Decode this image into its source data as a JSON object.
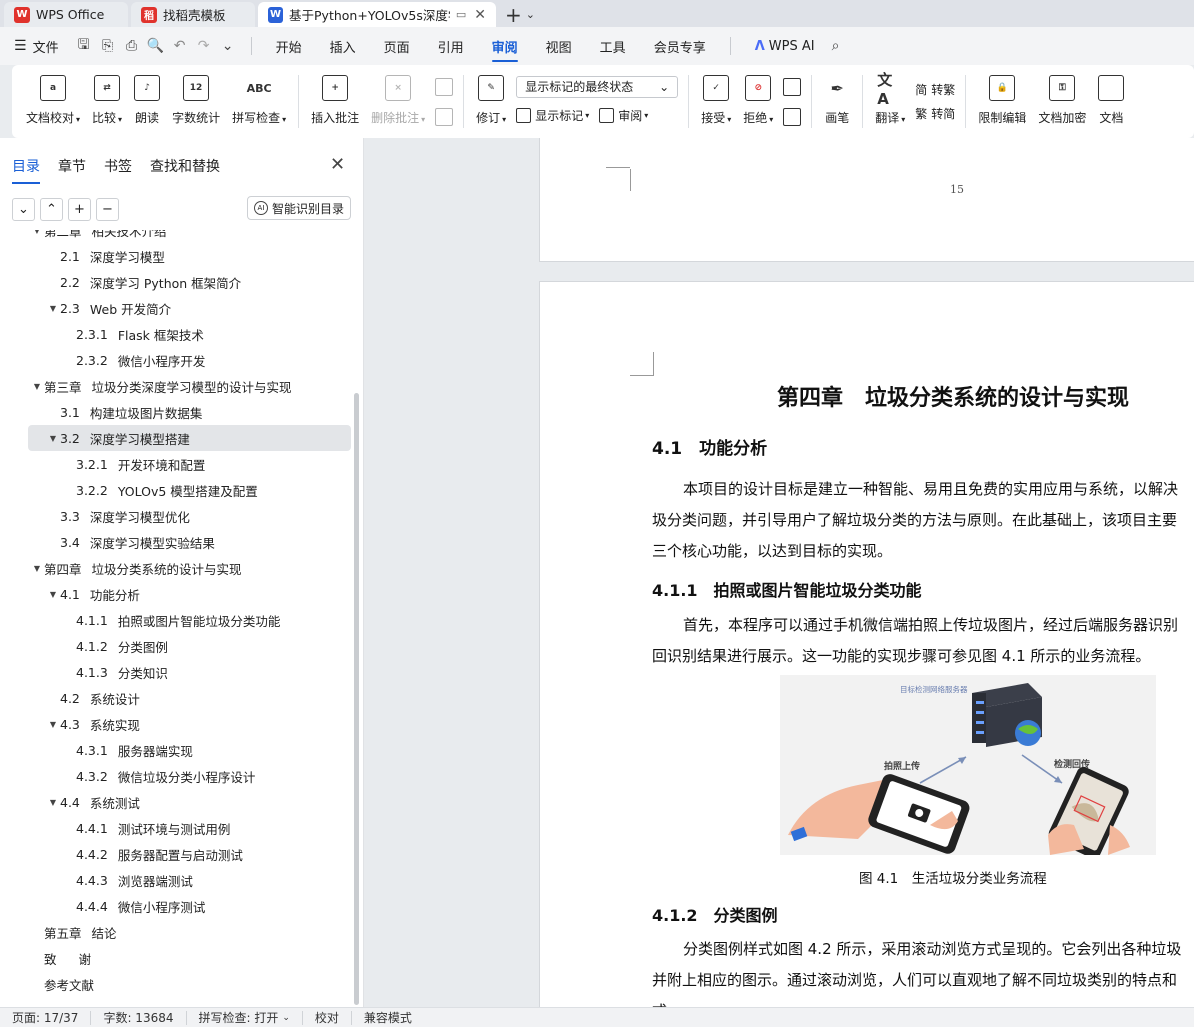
{
  "tabs": [
    {
      "label": "WPS Office",
      "logo": "W",
      "logo_color": "#e0322c",
      "active": false
    },
    {
      "label": "找稻壳模板",
      "logo": "稻",
      "logo_color": "#e0322c",
      "active": false
    },
    {
      "label": "基于Python+YOLOv5s深度学",
      "logo": "W",
      "logo_color": "#2b62d8",
      "active": true
    }
  ],
  "menubar": {
    "file_label": "文件",
    "items": [
      "开始",
      "插入",
      "页面",
      "引用",
      "审阅",
      "视图",
      "工具",
      "会员专享"
    ],
    "active_item": "审阅",
    "ai_label": "WPS AI"
  },
  "ribbon": {
    "proofread": "文档校对",
    "compare": "比较",
    "read_aloud": "朗读",
    "word_count": "字数统计",
    "spell_check": "拼写检查",
    "insert_comment": "插入批注",
    "delete_comment": "删除批注",
    "track_changes": "修订",
    "markup_state": "显示标记的最终状态",
    "show_markup": "显示标记",
    "review": "审阅",
    "accept": "接受",
    "reject": "拒绝",
    "ink": "画笔",
    "translate": "翻译",
    "to_traditional": "转繁",
    "to_simplified": "转简",
    "restrict_edit": "限制编辑",
    "encrypt": "文档加密",
    "doc_more": "文档"
  },
  "nav": {
    "tabs": [
      "目录",
      "章节",
      "书签",
      "查找和替换"
    ],
    "active_tab": "目录",
    "smart_toc": "智能识别目录",
    "toc": [
      {
        "level": 0,
        "arrow": "▼",
        "num": "第二章",
        "text": "相关技术介绍",
        "clipped": true
      },
      {
        "level": 1,
        "arrow": "",
        "num": "2.1",
        "text": "深度学习模型"
      },
      {
        "level": 1,
        "arrow": "",
        "num": "2.2",
        "text": "深度学习 Python 框架简介"
      },
      {
        "level": 1,
        "arrow": "▼",
        "num": "2.3",
        "text": "Web 开发简介"
      },
      {
        "level": 2,
        "arrow": "",
        "num": "2.3.1",
        "text": "Flask 框架技术"
      },
      {
        "level": 2,
        "arrow": "",
        "num": "2.3.2",
        "text": "微信小程序开发"
      },
      {
        "level": 0,
        "arrow": "▼",
        "num": "第三章",
        "text": "垃圾分类深度学习模型的设计与实现"
      },
      {
        "level": 1,
        "arrow": "",
        "num": "3.1",
        "text": "构建垃圾图片数据集"
      },
      {
        "level": 1,
        "arrow": "▼",
        "num": "3.2",
        "text": "深度学习模型搭建",
        "highlight": true
      },
      {
        "level": 2,
        "arrow": "",
        "num": "3.2.1",
        "text": "开发环境和配置"
      },
      {
        "level": 2,
        "arrow": "",
        "num": "3.2.2",
        "text": "YOLOv5 模型搭建及配置"
      },
      {
        "level": 1,
        "arrow": "",
        "num": "3.3",
        "text": "深度学习模型优化"
      },
      {
        "level": 1,
        "arrow": "",
        "num": "3.4",
        "text": "深度学习模型实验结果"
      },
      {
        "level": 0,
        "arrow": "▼",
        "num": "第四章",
        "text": "垃圾分类系统的设计与实现"
      },
      {
        "level": 1,
        "arrow": "▼",
        "num": "4.1",
        "text": "功能分析"
      },
      {
        "level": 2,
        "arrow": "",
        "num": "4.1.1",
        "text": "拍照或图片智能垃圾分类功能"
      },
      {
        "level": 2,
        "arrow": "",
        "num": "4.1.2",
        "text": "分类图例"
      },
      {
        "level": 2,
        "arrow": "",
        "num": "4.1.3",
        "text": "分类知识"
      },
      {
        "level": 1,
        "arrow": "",
        "num": "4.2",
        "text": "系统设计"
      },
      {
        "level": 1,
        "arrow": "▼",
        "num": "4.3",
        "text": "系统实现"
      },
      {
        "level": 2,
        "arrow": "",
        "num": "4.3.1",
        "text": "服务器端实现"
      },
      {
        "level": 2,
        "arrow": "",
        "num": "4.3.2",
        "text": "微信垃圾分类小程序设计"
      },
      {
        "level": 1,
        "arrow": "▼",
        "num": "4.4",
        "text": "系统测试"
      },
      {
        "level": 2,
        "arrow": "",
        "num": "4.4.1",
        "text": "测试环境与测试用例"
      },
      {
        "level": 2,
        "arrow": "",
        "num": "4.4.2",
        "text": "服务器配置与启动测试"
      },
      {
        "level": 2,
        "arrow": "",
        "num": "4.4.3",
        "text": "浏览器端测试"
      },
      {
        "level": 2,
        "arrow": "",
        "num": "4.4.4",
        "text": "微信小程序测试"
      },
      {
        "level": 0,
        "arrow": "",
        "num": "第五章",
        "text": "结论"
      },
      {
        "level": 0,
        "arrow": "",
        "num": "致",
        "text": "谢"
      },
      {
        "level": 0,
        "arrow": "",
        "num": "参考文献",
        "text": ""
      }
    ]
  },
  "document": {
    "prev_page_number": "15",
    "chapter_title": "第四章　垃圾分类系统的设计与实现",
    "h_41": "4.1　功能分析",
    "p1": [
      "本项目的设计目标是建立一种智能、易用且免费的实用应用与系统，以解决",
      "圾分类问题，并引导用户了解垃圾分类的方法与原则。在此基础上，该项目主要",
      "三个核心功能，以达到目标的实现。"
    ],
    "h_411": "4.1.1　拍照或图片智能垃圾分类功能",
    "p2": [
      "首先，本程序可以通过手机微信端拍照上传垃圾图片，经过后端服务器识别",
      "回识别结果进行展示。这一功能的实现步骤可参见图 4.1 所示的业务流程。"
    ],
    "figure_labels": {
      "server": "目标检测网络服务器",
      "upload": "拍照上传",
      "return": "检测回传"
    },
    "caption": "图 4.1　生活垃圾分类业务流程",
    "h_412": "4.1.2　分类图例",
    "p3": [
      "分类图例样式如图 4.2 所示，采用滚动浏览方式呈现的。它会列出各种垃圾",
      "并附上相应的图示。通过滚动浏览，人们可以直观地了解不同垃圾类别的特点和",
      "式"
    ]
  },
  "status": {
    "page": "页面: 17/37",
    "words": "字数: 13684",
    "spell": "拼写检查: 打开",
    "proof": "校对",
    "compat": "兼容模式"
  }
}
